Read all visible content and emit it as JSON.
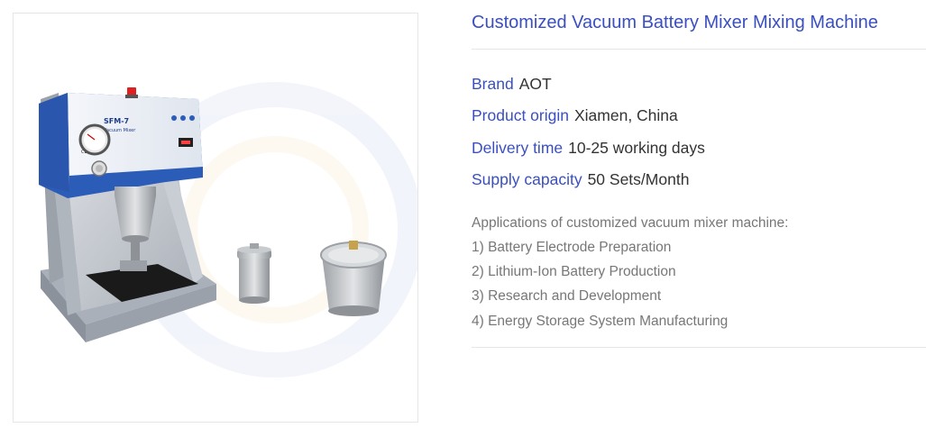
{
  "product": {
    "title": "Customized Vacuum Battery Mixer Mixing Machine",
    "image": {
      "machine_label": "SFM-7",
      "machine_sublabel": "Vacuum Mixer",
      "ce_mark": "CE",
      "colors": {
        "body": "#c7cacf",
        "panel": "#2b5cb8",
        "panel_light": "#e9eef6",
        "steel": "#b5b7b9",
        "red_button": "#e02020"
      }
    },
    "specs": [
      {
        "key": "Brand",
        "value": "AOT"
      },
      {
        "key": "Product origin",
        "value": "Xiamen, China"
      },
      {
        "key": "Delivery time",
        "value": "10-25 working days"
      },
      {
        "key": "Supply capacity",
        "value": "50 Sets/Month"
      }
    ],
    "description": {
      "heading": "Applications of customized vacuum mixer machine:",
      "items": [
        "1) Battery Electrode Preparation",
        "2) Lithium-Ion Battery Production",
        "3) Research and Development",
        "4) Energy Storage System Manufacturing"
      ]
    }
  },
  "colors": {
    "accent": "#3a4fc0",
    "text": "#333333",
    "muted": "#777777",
    "divider": "#e6e6e6"
  }
}
